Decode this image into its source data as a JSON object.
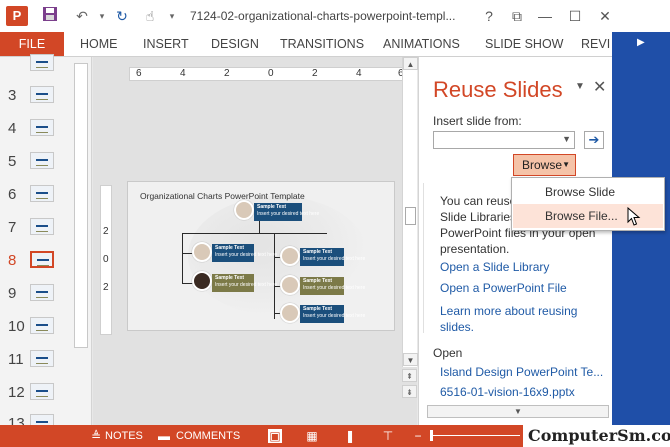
{
  "window": {
    "title": "7124-02-organizational-charts-powerpoint-templ...",
    "app_icon_label": "P",
    "quick_access": [
      "save-icon",
      "undo-icon",
      "redo-icon",
      "touch-mode-icon"
    ],
    "controls": {
      "help": "?",
      "restore": "⧉",
      "minimize": "—",
      "maximize": "☐",
      "close": "✕"
    }
  },
  "ribbon": {
    "tabs": [
      "FILE",
      "HOME",
      "INSERT",
      "DESIGN",
      "TRANSITIONS",
      "ANIMATIONS",
      "SLIDE SHOW",
      "REVI"
    ],
    "accent": "#d24726"
  },
  "thumbnails": {
    "numbers": [
      "3",
      "4",
      "5",
      "6",
      "7",
      "8",
      "9",
      "10",
      "11",
      "12",
      "13"
    ],
    "selected": "8"
  },
  "ruler": {
    "h_labels": [
      "6",
      "4",
      "2",
      "0",
      "2",
      "4",
      "6"
    ],
    "v_labels": [
      "2",
      "0",
      "2"
    ]
  },
  "slide": {
    "title": "Organizational Charts PowerPoint Template",
    "node_title": "Sample Text",
    "node_body": "Insert your desired text here"
  },
  "pane": {
    "title": "Reuse Slides",
    "insert_label": "Insert slide from:",
    "browse_label": "Browse",
    "body_lines": [
      "You can reuse",
      "Slide Libraries",
      "PowerPoint files in your open",
      "presentation."
    ],
    "links": [
      "Open a Slide Library",
      "Open a PowerPoint File",
      "Learn more about reusing",
      "slides."
    ],
    "open_label": "Open",
    "recent_files": [
      "Island Design PowerPoint Te...",
      "6516-01-vision-16x9.pptx"
    ]
  },
  "dropdown": {
    "items": [
      "Browse Slide Library...",
      "Browse File..."
    ],
    "hovered_index": 1
  },
  "status": {
    "notes": "NOTES",
    "comments": "COMMENTS",
    "watermark": "ComputerSm.com"
  }
}
